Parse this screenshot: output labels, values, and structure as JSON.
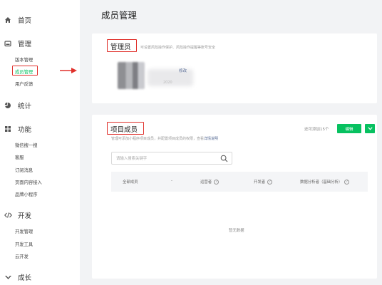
{
  "sidebar": {
    "sections": [
      {
        "id": "home",
        "title": "首页",
        "icon": "home-icon"
      },
      {
        "id": "manage",
        "title": "管理",
        "icon": "manage-icon",
        "items": [
          "版本管理",
          "成员管理",
          "用户反馈"
        ]
      },
      {
        "id": "stats",
        "title": "统计",
        "icon": "pie-chart-icon"
      },
      {
        "id": "features",
        "title": "功能",
        "icon": "grid-icon",
        "items": [
          "微信搜一搜",
          "客服",
          "订阅消息",
          "页面内容接入",
          "品牌小程序"
        ]
      },
      {
        "id": "dev",
        "title": "开发",
        "icon": "code-icon",
        "items": [
          "开发管理",
          "开发工具",
          "云开发"
        ]
      },
      {
        "id": "growth",
        "title": "成长",
        "icon": "growth-icon"
      }
    ],
    "active_item": "成员管理"
  },
  "main": {
    "page_title": "成员管理",
    "admin_card": {
      "title": "管理员",
      "desc": "可设置风险操作保护、风险操作提醒等账号安全",
      "avatar_caption": "2020",
      "modify_label": "修改"
    },
    "project_card": {
      "title": "项目成员",
      "desc_prefix": "管理可添加小程序项目成员，并配置项目成员的权限，查看",
      "desc_link": "详情说明",
      "quota_text": "还可添加15个",
      "edit_button": "编辑",
      "search_placeholder": "请输入搜索关键字",
      "columns": [
        "全部成员",
        "-",
        "运营者",
        "开发者",
        "数据分析者（基础分析）"
      ],
      "empty_text": "暂无数据"
    }
  },
  "colors": {
    "accent_green": "#07c160",
    "annotation_red": "#e0302b",
    "link_blue": "#576b95"
  }
}
